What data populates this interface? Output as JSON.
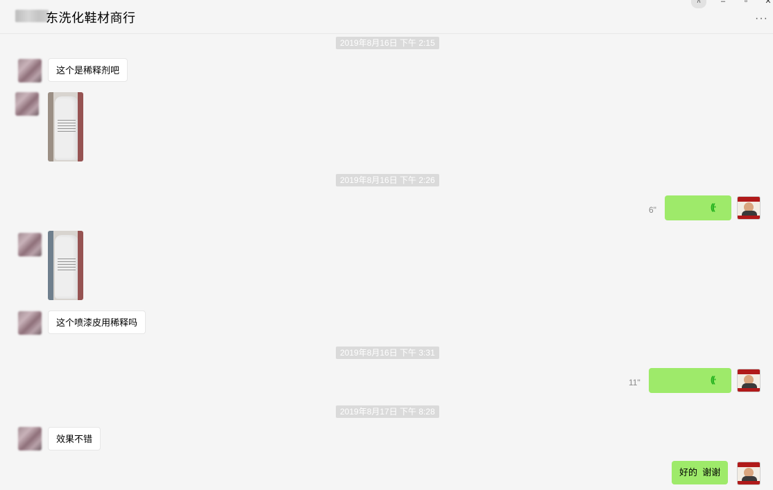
{
  "header": {
    "title": "东洗化鞋材商行",
    "window_buttons": {
      "pin": "⊼",
      "minimize": "–",
      "maximize": "▫",
      "close": "✕"
    },
    "more": "···"
  },
  "messages": [
    {
      "type": "time",
      "text": "2019年8月16日 下午 2:15"
    },
    {
      "type": "text",
      "side": "left",
      "text": "这个是稀释剂吧"
    },
    {
      "type": "image",
      "side": "left"
    },
    {
      "type": "time",
      "text": "2019年8月16日 下午 2:26"
    },
    {
      "type": "voice",
      "side": "right",
      "duration": "6\""
    },
    {
      "type": "image",
      "side": "left"
    },
    {
      "type": "text",
      "side": "left",
      "text": "这个喷漆皮用稀释吗"
    },
    {
      "type": "time",
      "text": "2019年8月16日 下午 3:31"
    },
    {
      "type": "voice",
      "side": "right",
      "duration": "11\""
    },
    {
      "type": "time",
      "text": "2019年8月17日 下午 8:28"
    },
    {
      "type": "text",
      "side": "left",
      "text": "效果不错"
    },
    {
      "type": "text",
      "side": "right",
      "text": "好的  谢谢"
    }
  ],
  "icons": {
    "voice": "((·"
  },
  "colors": {
    "background": "#f5f5f5",
    "bubble_self": "#9eea6a",
    "bubble_other": "#ffffff",
    "timestamp_bg": "#dadada"
  }
}
